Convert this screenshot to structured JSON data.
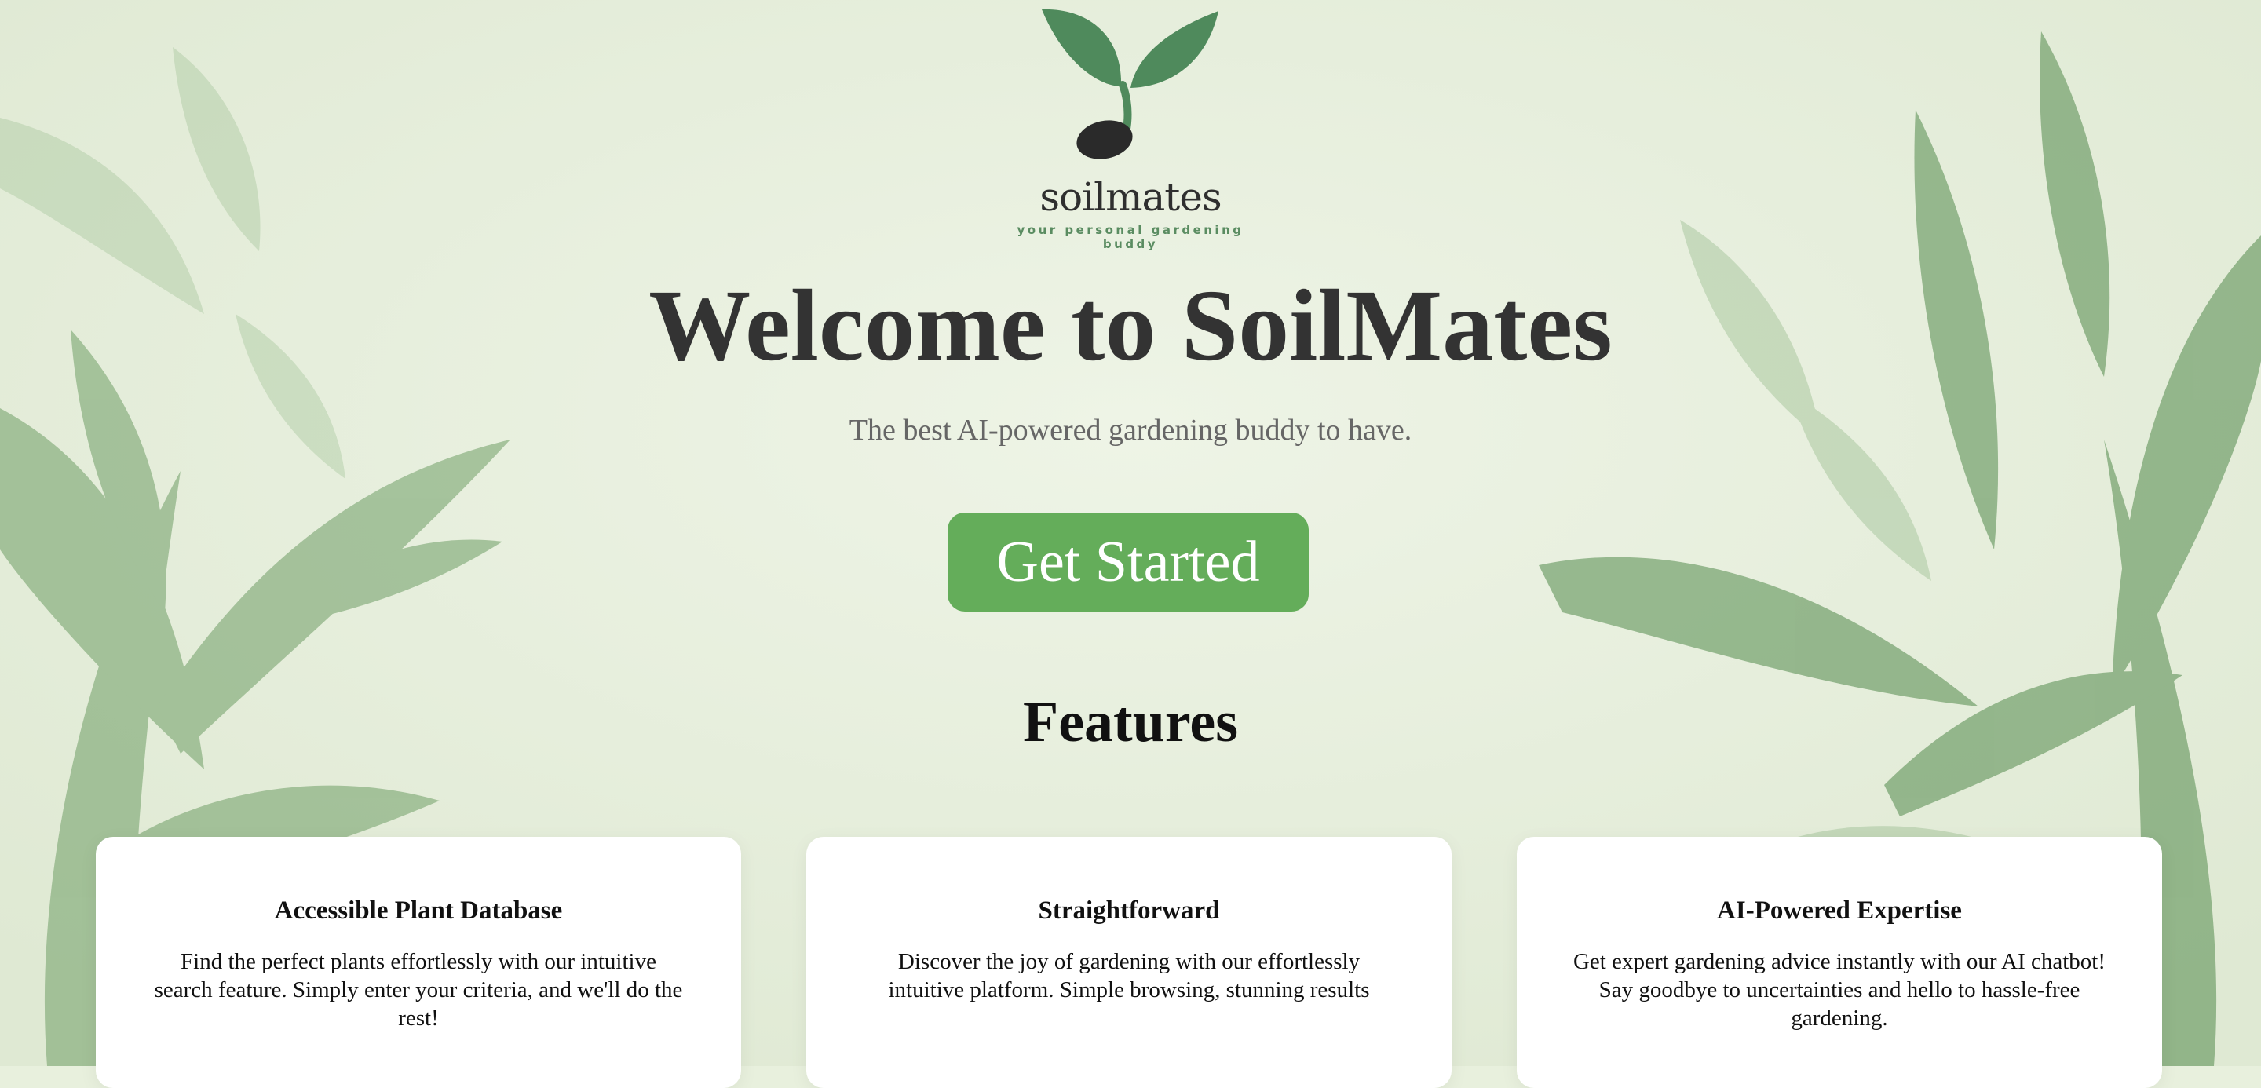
{
  "brand": {
    "name": "soilmates",
    "tagline": "your personal gardening buddy"
  },
  "hero": {
    "title": "Welcome to SoilMates",
    "subtitle": "The best AI-powered gardening buddy to have.",
    "cta_label": "Get Started"
  },
  "features": {
    "heading": "Features",
    "items": [
      {
        "title": "Accessible Plant Database",
        "description": "Find the perfect plants effortlessly with our intuitive search feature. Simply enter your criteria, and we'll do the rest!"
      },
      {
        "title": "Straightforward",
        "description": "Discover the joy of gardening with our effortlessly intuitive platform. Simple browsing, stunning results"
      },
      {
        "title": "AI-Powered Expertise",
        "description": "Get expert gardening advice instantly with our AI chatbot! Say goodbye to uncertainties and hello to hassle-free gardening."
      }
    ]
  },
  "colors": {
    "background": "#e8f0dd",
    "leaf_dark": "#4f8a5c",
    "cta": "#64ad5a",
    "text_dark": "#333333",
    "text_muted": "#666666"
  }
}
